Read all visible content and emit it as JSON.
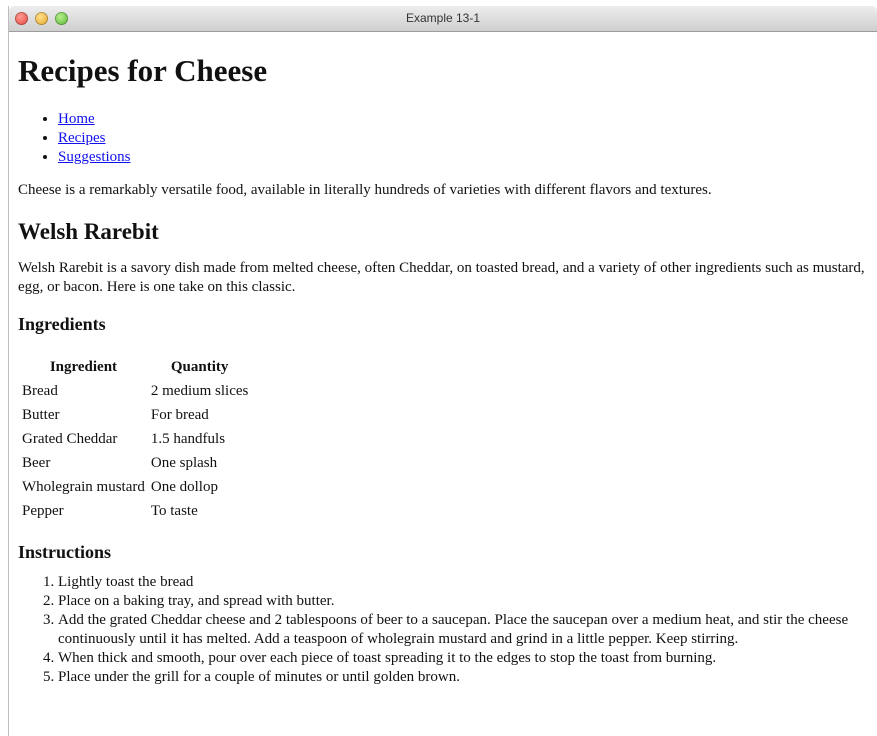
{
  "window": {
    "title": "Example 13-1"
  },
  "page": {
    "heading": "Recipes for Cheese",
    "nav": [
      {
        "label": "Home"
      },
      {
        "label": "Recipes"
      },
      {
        "label": "Suggestions"
      }
    ],
    "intro": "Cheese is a remarkably versatile food, available in literally hundreds of varieties with different flavors and textures.",
    "recipe": {
      "title": "Welsh Rarebit",
      "description": "Welsh Rarebit is a savory dish made from melted cheese, often Cheddar, on toasted bread, and a variety of other ingredients such as mustard, egg, or bacon. Here is one take on this classic.",
      "ingredients_heading": "Ingredients",
      "table": {
        "headers": [
          "Ingredient",
          "Quantity"
        ],
        "rows": [
          [
            "Bread",
            "2 medium slices"
          ],
          [
            "Butter",
            "For bread"
          ],
          [
            "Grated Cheddar",
            "1.5 handfuls"
          ],
          [
            "Beer",
            "One splash"
          ],
          [
            "Wholegrain mustard",
            "One dollop"
          ],
          [
            "Pepper",
            "To taste"
          ]
        ]
      },
      "instructions_heading": "Instructions",
      "steps": [
        "Lightly toast the bread",
        "Place on a baking tray, and spread with butter.",
        "Add the grated Cheddar cheese and 2 tablespoons of beer to a saucepan. Place the saucepan over a medium heat, and stir the cheese continuously until it has melted. Add a teaspoon of wholegrain mustard and grind in a little pepper. Keep stirring.",
        "When thick and smooth, pour over each piece of toast spreading it to the edges to stop the toast from burning.",
        "Place under the grill for a couple of minutes or until golden brown."
      ]
    }
  }
}
